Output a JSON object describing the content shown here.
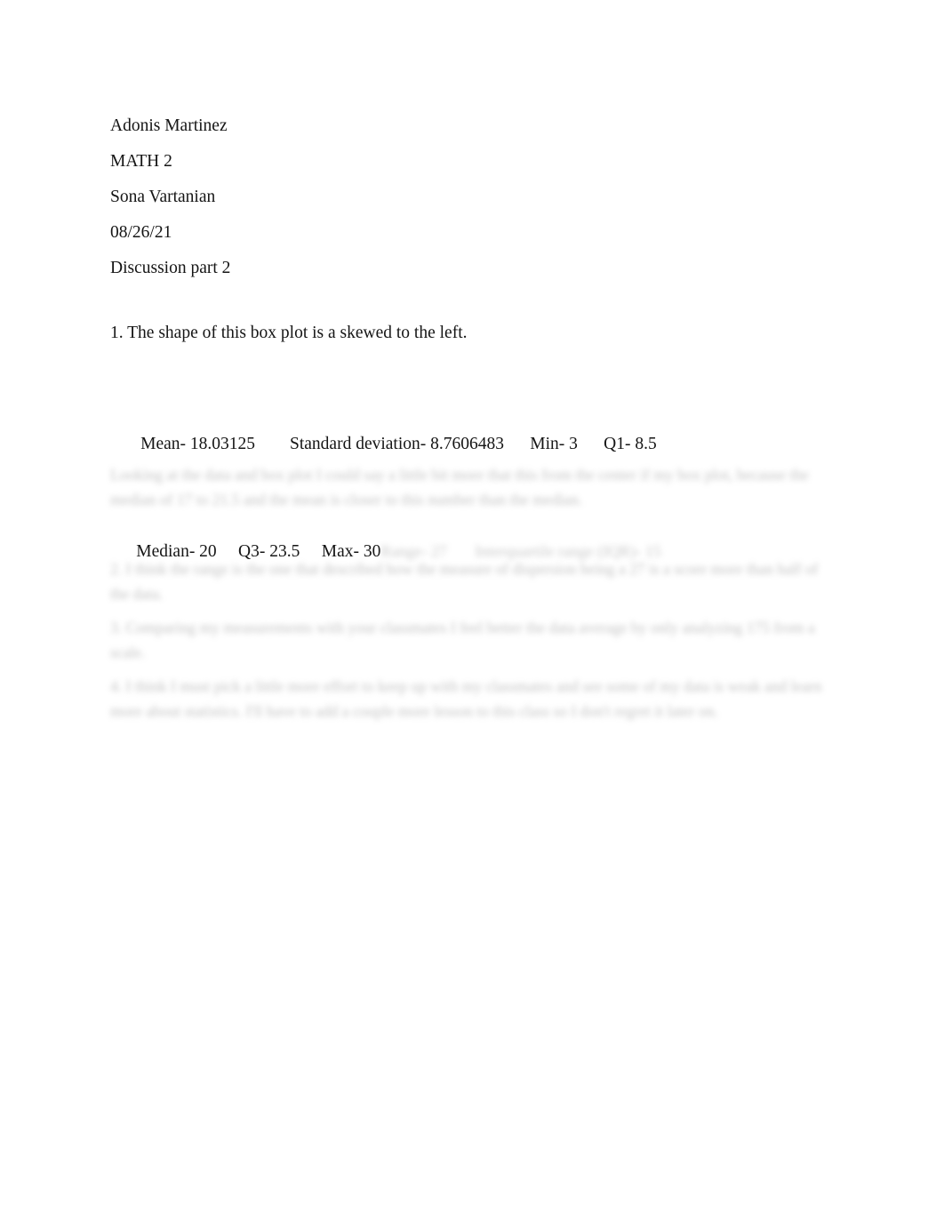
{
  "document": {
    "header_lines": [
      "Adonis Martinez",
      "MATH 2",
      "Sona Vartanian",
      "08/26/21",
      "Discussion part 2"
    ],
    "intro": "1. The shape of this box plot is a skewed to the left.",
    "statistics": {
      "row1": " Mean- 18.03125        Standard deviation- 8.7606483      Min- 3      Q1- 8.5",
      "row2": "Median- 20     Q3- 23.5     Max- 30",
      "row2_obscured": "Range- 27       Interquartile range (IQR)- 15"
    },
    "obscured_paragraphs": [
      "Looking at the data and box plot I could say a little bit more that this from the center if my box plot, because the median of 17 to 21.5 and the mean is closer to this number than the median.",
      "2. I think the range is the one that described how the measure of dispersion being a 27 is a score more than half of the data.",
      "3. Comparing my measurements with your classmates I feel better the data average by only analyzing 175 from a scale.",
      "4. I think I must pick a little more effort to keep up with my classmates and see some of my data is weak and learn more about statistics. I'll have to add a couple more lesson to this class so I don't regret it later on."
    ],
    "colors": {
      "page_background": "#ffffff",
      "text": "#151515",
      "obscured_text": "#b9b9b9"
    }
  }
}
